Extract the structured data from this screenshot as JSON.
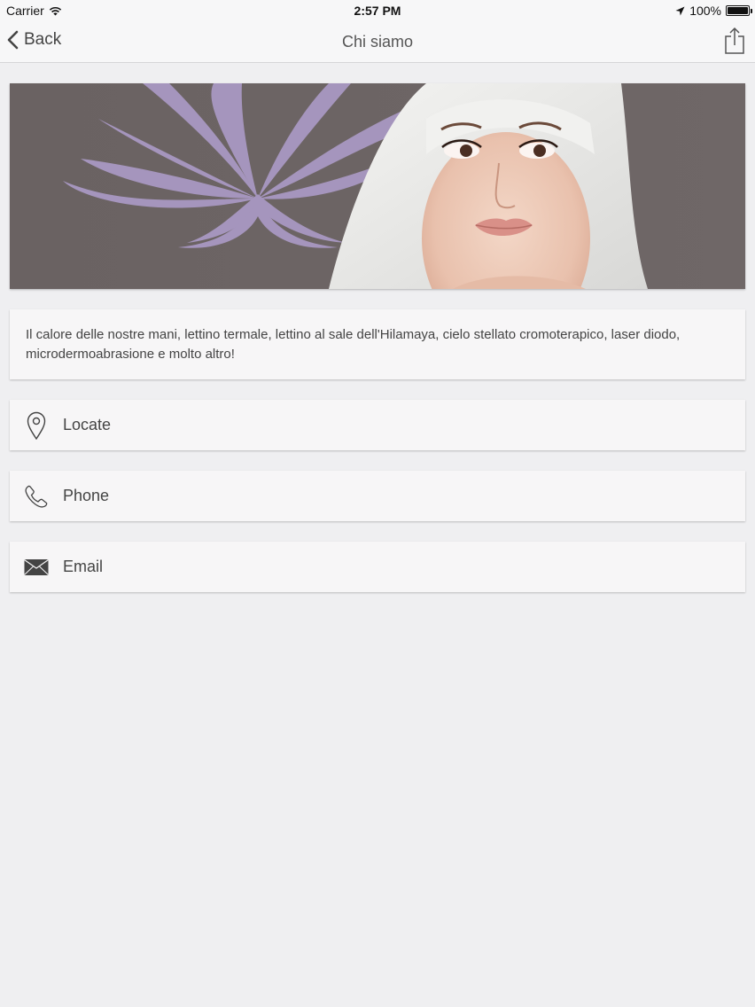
{
  "status": {
    "carrier": "Carrier",
    "time": "2:57 PM",
    "battery": "100%"
  },
  "nav": {
    "back_label": "Back",
    "title": "Chi siamo"
  },
  "description": "Il calore delle nostre mani, lettino termale, lettino al sale dell'Hilamaya, cielo stellato cromoterapico, laser diodo, microdermoabrasione e molto altro!",
  "actions": {
    "locate": {
      "label": "Locate",
      "icon": "map-pin-icon"
    },
    "phone": {
      "label": "Phone",
      "icon": "phone-icon"
    },
    "email": {
      "label": "Email",
      "icon": "envelope-icon"
    }
  },
  "colors": {
    "background": "#efeff1",
    "card": "#f7f6f7",
    "banner_bg": "#6e6565",
    "lotus": "#a998c2"
  }
}
